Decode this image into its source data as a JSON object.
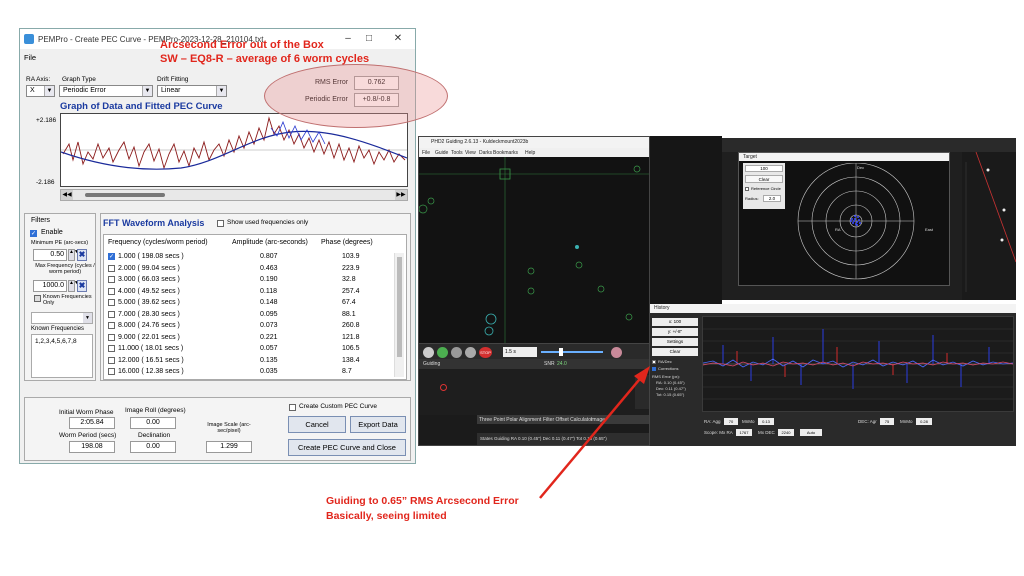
{
  "pempro": {
    "title": "PEMPro - Create PEC Curve - PEMPro-2023-12-28_210104.txt",
    "menu_file": "File",
    "ra_axis_label": "RA Axis:",
    "ra_axis_value": "X",
    "graph_type_label": "Graph Type",
    "graph_type_value": "Periodic Error",
    "drift_fitting_label": "Drift Fitting",
    "drift_fitting_value": "Linear",
    "rms_error_label": "RMS Error",
    "rms_error_value": "0.762",
    "periodic_error_label": "Periodic Error",
    "periodic_error_value": "+0.8/-0.8",
    "graph_title": "Graph of Data and Fitted PEC Curve",
    "y_top": "+2.186",
    "y_bottom": "-2.186",
    "filters_title": "Filters",
    "enable_label": "Enable",
    "min_pe_label": "Minimum PE (arc-secs)",
    "min_pe_value": "0.50",
    "max_freq_label": "Max Frequency (cycles / worm period)",
    "max_freq_value": "1000.0",
    "known_freq_only_label": "Known Frequencies Only",
    "known_freqs_label": "Known Frequencies",
    "known_freqs_value": "1,2,3,4,5,6,7,8",
    "fft_title": "FFT Waveform Analysis",
    "show_used_label": "Show used frequencies only",
    "col_freq": "Frequency (cycles/worm period)",
    "col_amp": "Amplitude (arc-seconds)",
    "col_phase": "Phase (degrees)",
    "fft_rows": [
      {
        "checked": true,
        "freq": "1.000  ( 198.08 secs )",
        "amp": "0.807",
        "phase": "103.9"
      },
      {
        "checked": false,
        "freq": "2.000  ( 99.04 secs )",
        "amp": "0.463",
        "phase": "223.9"
      },
      {
        "checked": false,
        "freq": "3.000  ( 66.03 secs )",
        "amp": "0.190",
        "phase": "32.8"
      },
      {
        "checked": false,
        "freq": "4.000  ( 49.52 secs )",
        "amp": "0.118",
        "phase": "257.4"
      },
      {
        "checked": false,
        "freq": "5.000  ( 39.62 secs )",
        "amp": "0.148",
        "phase": "67.4"
      },
      {
        "checked": false,
        "freq": "7.000  ( 28.30 secs )",
        "amp": "0.095",
        "phase": "88.1"
      },
      {
        "checked": false,
        "freq": "8.000  ( 24.76 secs )",
        "amp": "0.073",
        "phase": "260.8"
      },
      {
        "checked": false,
        "freq": "9.000  ( 22.01 secs )",
        "amp": "0.221",
        "phase": "121.8"
      },
      {
        "checked": false,
        "freq": "11.000  ( 18.01 secs )",
        "amp": "0.057",
        "phase": "106.5"
      },
      {
        "checked": false,
        "freq": "12.000  ( 16.51 secs )",
        "amp": "0.135",
        "phase": "138.4"
      },
      {
        "checked": false,
        "freq": "16.000  ( 12.38 secs )",
        "amp": "0.035",
        "phase": "8.7"
      },
      {
        "checked": false,
        "freq": "18.000  ( 11.00 secs )",
        "amp": "0.119",
        "phase": "88.2"
      }
    ],
    "initial_worm_phase_label": "Initial Worm Phase",
    "initial_worm_phase_value": "2:05.84",
    "worm_period_label": "Worm Period (secs)",
    "worm_period_value": "198.08",
    "image_roll_label": "Image Roll (degrees)",
    "image_roll_value": "0.00",
    "declination_label": "Declination",
    "declination_value": "0.00",
    "image_scale_label": "Image Scale (arc-sec/pixel)",
    "image_scale_value": "1.299",
    "create_custom_label": "Create Custom PEC Curve",
    "cancel_label": "Cancel",
    "export_label": "Export Data",
    "create_close_label": "Create PEC Curve and Close"
  },
  "annotations": {
    "top_line1": "Arcsecond Error out of the Box",
    "top_line2": "SW – EQ8-R – average of 6 worm cycles",
    "bottom_line1": "Guiding to 0.65” RMS Arcsecond Error",
    "bottom_line2": "Basically, seeing limited",
    "accent": "#e1261c"
  },
  "phd": {
    "title": "PHD2 Guiding 2.6.13 - Kuldeckmount2023b",
    "menu": [
      "File",
      "Guide",
      "Tools",
      "View",
      "Darks",
      "Bookmarks",
      "Help"
    ],
    "exposure": "1.5 s",
    "snr_label": "SNR",
    "snr_value": "24.0",
    "status": "Guiding",
    "tabs": [
      "Three Point Polar Alignment",
      "Filter Offset Calculator",
      "Image"
    ],
    "status_bar": "States Guiding RA 0.10 (0.45\") Dec 0.11 (0.47\") Tot 0.15 (0.65\")"
  },
  "target": {
    "title": "Target",
    "zoom": "100",
    "clear": "Clear",
    "ref_circle": "Reference Circle",
    "radius_label": "Radius:",
    "radius_value": "2.0",
    "dec_label": "Dec",
    "ra_label": "RA",
    "east_label": "East"
  },
  "history": {
    "title": "History",
    "x_select": "x: 100",
    "y_select": "y: +/-8\"",
    "settings": "Settings",
    "clear": "Clear",
    "legend": [
      "RA/Dec",
      "Corrections"
    ],
    "rms_title": "RMS Error (px):",
    "rms_ra": "RA: 0.10 (0.45\")",
    "rms_dec": "Dec: 0.11 (0.47\")",
    "rms_tot": "Tot: 0.15 (0.65\")",
    "ra_agg_label": "RA: Agg",
    "ra_agg": "70",
    "minmo_label": "MnMo",
    "ra_minmo": "0.13",
    "dec_agr_label": "DEC: Agr",
    "dec_agr": "75",
    "dec_minmo": "0.28",
    "scope_mx_ra_label": "Scope: Mx RA",
    "scope_mx_ra": "1767",
    "mx_dec_label": "Mx DEC",
    "mx_dec": "2240",
    "dec_mode": "Auto"
  }
}
